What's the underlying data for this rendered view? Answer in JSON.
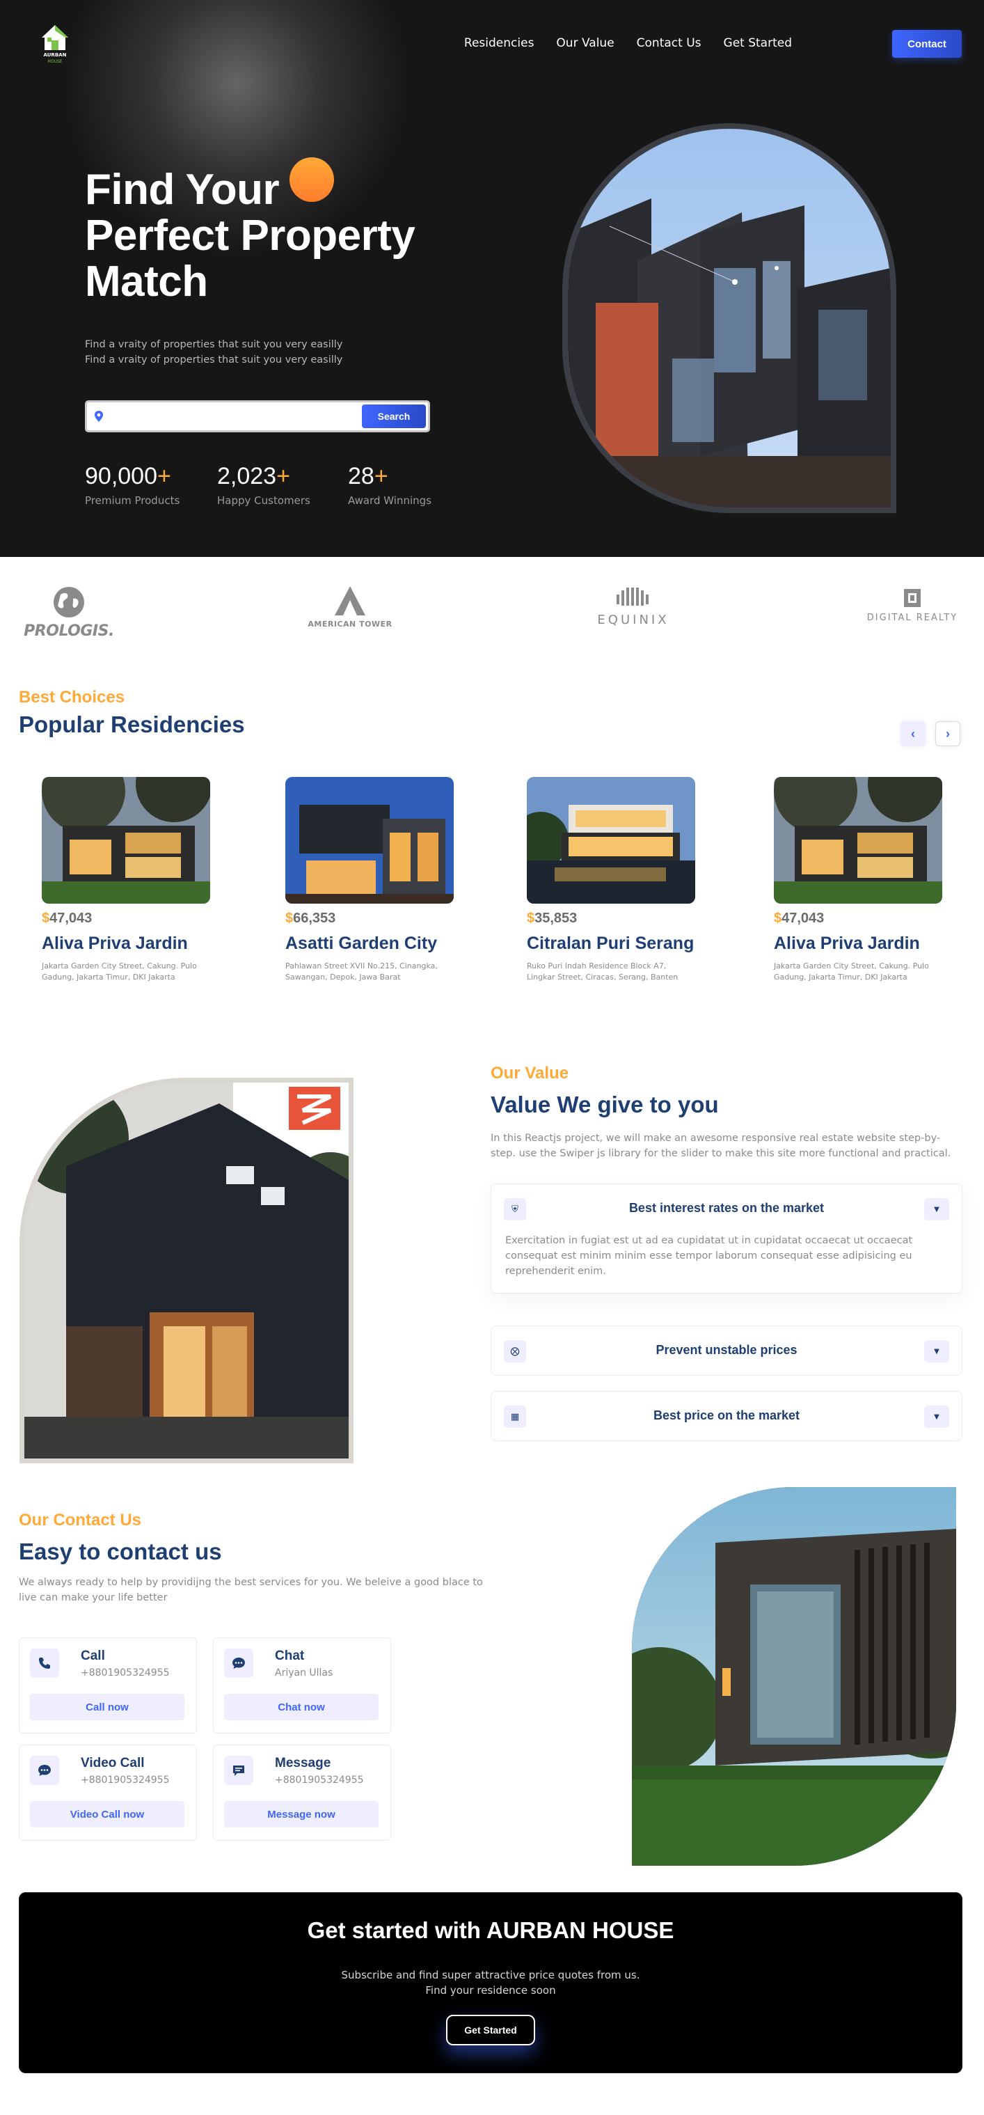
{
  "nav": {
    "logo_line1": "AURBAN",
    "logo_line2": "HOUSE",
    "links": [
      "Residencies",
      "Our Value",
      "Contact Us",
      "Get Started"
    ],
    "contact_button": "Contact"
  },
  "hero": {
    "title_lines": [
      "Find Your",
      "Perfect Property",
      "Match"
    ],
    "subtitle_lines": [
      "Find a vraity of properties that suit you very easilly",
      "Find a vraity of properties that suit you very easilly"
    ],
    "search_placeholder": "",
    "search_button": "Search",
    "stats": [
      {
        "value": "90,000",
        "plus": "+",
        "label": "Premium Products"
      },
      {
        "value": "2,023",
        "plus": "+",
        "label": "Happy Customers"
      },
      {
        "value": "28",
        "plus": "+",
        "label": "Award Winnings"
      }
    ]
  },
  "brands": [
    {
      "name": "PROLOGIS.",
      "icon": "globe-icon"
    },
    {
      "name": "AMERICAN TOWER",
      "icon": "tower-icon"
    },
    {
      "name": "EQUINIX",
      "icon": "equinix-icon"
    },
    {
      "name": "DIGITAL REALTY",
      "icon": "digital-realty-icon"
    }
  ],
  "residencies": {
    "eyebrow": "Best Choices",
    "title": "Popular Residencies",
    "prev_icon": "chevron-left-icon",
    "next_icon": "chevron-right-icon",
    "cards": [
      {
        "currency": "$",
        "price": "47,043",
        "name": "Aliva Priva Jardin",
        "address": "Jakarta Garden City Street, Cakung. Pulo Gadung, Jakarta Timur, DKI Jakarta"
      },
      {
        "currency": "$",
        "price": "66,353",
        "name": "Asatti Garden City",
        "address": "Pahlawan Street XVII No.215, Cinangka, Sawangan, Depok, Jawa Barat"
      },
      {
        "currency": "$",
        "price": "35,853",
        "name": "Citralan Puri Serang",
        "address": "Ruko Puri Indah Residence Block A7, Lingkar Street, Ciracas, Serang, Banten"
      },
      {
        "currency": "$",
        "price": "47,043",
        "name": "Aliva Priva Jardin",
        "address": "Jakarta Garden City Street, Cakung. Pulo Gadung, Jakarta Timur, DKI Jakarta"
      }
    ]
  },
  "value": {
    "eyebrow": "Our Value",
    "title": "Value We give to you",
    "description": "In this Reactjs project, we will make an awesome responsive real estate website step-by-step. use the Swiper js library for the slider to make this site more functional and practical.",
    "items": [
      {
        "icon": "shield-icon",
        "title": "Best interest rates on the market",
        "body": "Exercitation in fugiat est ut ad ea cupidatat ut in cupidatat occaecat ut occaecat consequat est minim minim esse tempor laborum consequat esse adipisicing eu reprehenderit enim.",
        "expanded": true
      },
      {
        "icon": "close-circle-icon",
        "title": "Prevent unstable prices",
        "body": "",
        "expanded": false
      },
      {
        "icon": "chart-icon",
        "title": "Best price on the market",
        "body": "",
        "expanded": false
      }
    ],
    "toggle_icon": "chevron-down-icon"
  },
  "contact": {
    "eyebrow": "Our Contact Us",
    "title": "Easy to contact us",
    "description": "We always ready to help by providijng the best services for you. We beleive a good blace to live can make your life better",
    "modes": [
      {
        "icon": "phone-icon",
        "title": "Call",
        "value": "+8801905324955",
        "button": "Call now"
      },
      {
        "icon": "chat-icon",
        "title": "Chat",
        "value": "Ariyan Ullas",
        "button": "Chat now"
      },
      {
        "icon": "video-chat-icon",
        "title": "Video Call",
        "value": "+8801905324955",
        "button": "Video Call now"
      },
      {
        "icon": "message-icon",
        "title": "Message",
        "value": "+8801905324955",
        "button": "Message now"
      }
    ]
  },
  "get_started": {
    "title": "Get started with AURBAN HOUSE",
    "subtitle_lines": [
      "Subscribe and find super attractive price quotes from us.",
      "Find your residence soon"
    ],
    "button": "Get Started"
  },
  "colors": {
    "accent_blue": "#4066ff",
    "navy": "#1f3e72",
    "orange": "#ffa937",
    "hero_bg": "#161616"
  }
}
